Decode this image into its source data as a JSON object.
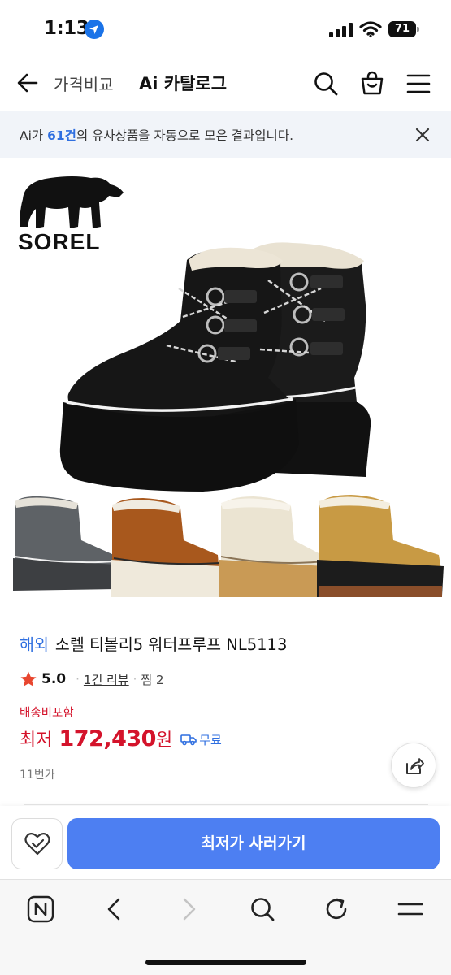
{
  "status_bar": {
    "time": "1:13",
    "battery": "71",
    "icons": [
      "location-arrow-icon",
      "signal-icon",
      "wifi-icon",
      "battery-icon"
    ]
  },
  "header": {
    "back_icon": "arrow-left-icon",
    "breadcrumb_prev": "가격비교",
    "breadcrumb_current": "Ai 카탈로그",
    "icons": [
      "search-icon",
      "shopping-bag-icon",
      "hamburger-menu-icon"
    ]
  },
  "notice": {
    "prefix": "Ai가 ",
    "count": "61건",
    "suffix": "의 유사상품을 자동으로 모은 결과입니다.",
    "close_icon": "close-icon"
  },
  "product": {
    "image_brand": "SOREL",
    "tag": "해외",
    "title": "소렐 티볼리5 워터프루프 NL5113",
    "rating": "5.0",
    "review_link": "1건 리뷰",
    "zzim": "찜 2",
    "shipping_note": "배송비포함",
    "price_label": "최저",
    "price_value": "172,430",
    "price_unit": "원",
    "free_shipping": "무료",
    "seller_count": "11번가"
  },
  "action_bar": {
    "wish_icon": "heart-check-icon",
    "buy_label": "최저가 사러가기"
  },
  "browser_bar": {
    "icons": [
      "naver-home-icon",
      "back-icon",
      "forward-icon",
      "search-icon",
      "refresh-icon",
      "menu-icon"
    ]
  },
  "colors": {
    "accent_blue": "#4d7ff2",
    "link_blue": "#2f6fe0",
    "price_red": "#d4132b",
    "notice_bg": "#f1f4f9"
  }
}
